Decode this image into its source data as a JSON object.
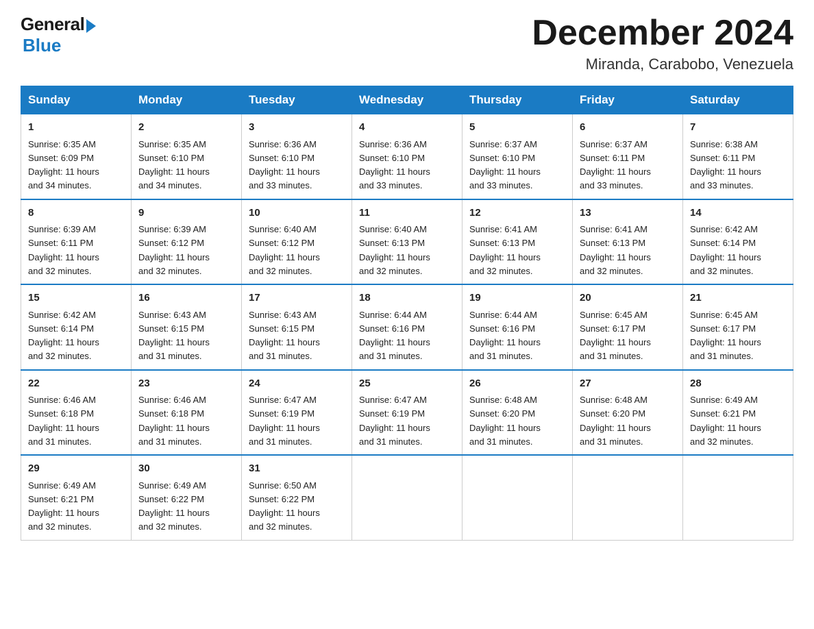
{
  "logo": {
    "general": "General",
    "blue": "Blue"
  },
  "title": "December 2024",
  "location": "Miranda, Carabobo, Venezuela",
  "headers": [
    "Sunday",
    "Monday",
    "Tuesday",
    "Wednesday",
    "Thursday",
    "Friday",
    "Saturday"
  ],
  "weeks": [
    [
      {
        "day": "1",
        "sunrise": "6:35 AM",
        "sunset": "6:09 PM",
        "daylight": "11 hours and 34 minutes."
      },
      {
        "day": "2",
        "sunrise": "6:35 AM",
        "sunset": "6:10 PM",
        "daylight": "11 hours and 34 minutes."
      },
      {
        "day": "3",
        "sunrise": "6:36 AM",
        "sunset": "6:10 PM",
        "daylight": "11 hours and 33 minutes."
      },
      {
        "day": "4",
        "sunrise": "6:36 AM",
        "sunset": "6:10 PM",
        "daylight": "11 hours and 33 minutes."
      },
      {
        "day": "5",
        "sunrise": "6:37 AM",
        "sunset": "6:10 PM",
        "daylight": "11 hours and 33 minutes."
      },
      {
        "day": "6",
        "sunrise": "6:37 AM",
        "sunset": "6:11 PM",
        "daylight": "11 hours and 33 minutes."
      },
      {
        "day": "7",
        "sunrise": "6:38 AM",
        "sunset": "6:11 PM",
        "daylight": "11 hours and 33 minutes."
      }
    ],
    [
      {
        "day": "8",
        "sunrise": "6:39 AM",
        "sunset": "6:11 PM",
        "daylight": "11 hours and 32 minutes."
      },
      {
        "day": "9",
        "sunrise": "6:39 AM",
        "sunset": "6:12 PM",
        "daylight": "11 hours and 32 minutes."
      },
      {
        "day": "10",
        "sunrise": "6:40 AM",
        "sunset": "6:12 PM",
        "daylight": "11 hours and 32 minutes."
      },
      {
        "day": "11",
        "sunrise": "6:40 AM",
        "sunset": "6:13 PM",
        "daylight": "11 hours and 32 minutes."
      },
      {
        "day": "12",
        "sunrise": "6:41 AM",
        "sunset": "6:13 PM",
        "daylight": "11 hours and 32 minutes."
      },
      {
        "day": "13",
        "sunrise": "6:41 AM",
        "sunset": "6:13 PM",
        "daylight": "11 hours and 32 minutes."
      },
      {
        "day": "14",
        "sunrise": "6:42 AM",
        "sunset": "6:14 PM",
        "daylight": "11 hours and 32 minutes."
      }
    ],
    [
      {
        "day": "15",
        "sunrise": "6:42 AM",
        "sunset": "6:14 PM",
        "daylight": "11 hours and 32 minutes."
      },
      {
        "day": "16",
        "sunrise": "6:43 AM",
        "sunset": "6:15 PM",
        "daylight": "11 hours and 31 minutes."
      },
      {
        "day": "17",
        "sunrise": "6:43 AM",
        "sunset": "6:15 PM",
        "daylight": "11 hours and 31 minutes."
      },
      {
        "day": "18",
        "sunrise": "6:44 AM",
        "sunset": "6:16 PM",
        "daylight": "11 hours and 31 minutes."
      },
      {
        "day": "19",
        "sunrise": "6:44 AM",
        "sunset": "6:16 PM",
        "daylight": "11 hours and 31 minutes."
      },
      {
        "day": "20",
        "sunrise": "6:45 AM",
        "sunset": "6:17 PM",
        "daylight": "11 hours and 31 minutes."
      },
      {
        "day": "21",
        "sunrise": "6:45 AM",
        "sunset": "6:17 PM",
        "daylight": "11 hours and 31 minutes."
      }
    ],
    [
      {
        "day": "22",
        "sunrise": "6:46 AM",
        "sunset": "6:18 PM",
        "daylight": "11 hours and 31 minutes."
      },
      {
        "day": "23",
        "sunrise": "6:46 AM",
        "sunset": "6:18 PM",
        "daylight": "11 hours and 31 minutes."
      },
      {
        "day": "24",
        "sunrise": "6:47 AM",
        "sunset": "6:19 PM",
        "daylight": "11 hours and 31 minutes."
      },
      {
        "day": "25",
        "sunrise": "6:47 AM",
        "sunset": "6:19 PM",
        "daylight": "11 hours and 31 minutes."
      },
      {
        "day": "26",
        "sunrise": "6:48 AM",
        "sunset": "6:20 PM",
        "daylight": "11 hours and 31 minutes."
      },
      {
        "day": "27",
        "sunrise": "6:48 AM",
        "sunset": "6:20 PM",
        "daylight": "11 hours and 31 minutes."
      },
      {
        "day": "28",
        "sunrise": "6:49 AM",
        "sunset": "6:21 PM",
        "daylight": "11 hours and 32 minutes."
      }
    ],
    [
      {
        "day": "29",
        "sunrise": "6:49 AM",
        "sunset": "6:21 PM",
        "daylight": "11 hours and 32 minutes."
      },
      {
        "day": "30",
        "sunrise": "6:49 AM",
        "sunset": "6:22 PM",
        "daylight": "11 hours and 32 minutes."
      },
      {
        "day": "31",
        "sunrise": "6:50 AM",
        "sunset": "6:22 PM",
        "daylight": "11 hours and 32 minutes."
      },
      null,
      null,
      null,
      null
    ]
  ],
  "labels": {
    "sunrise": "Sunrise:",
    "sunset": "Sunset:",
    "daylight": "Daylight:"
  }
}
